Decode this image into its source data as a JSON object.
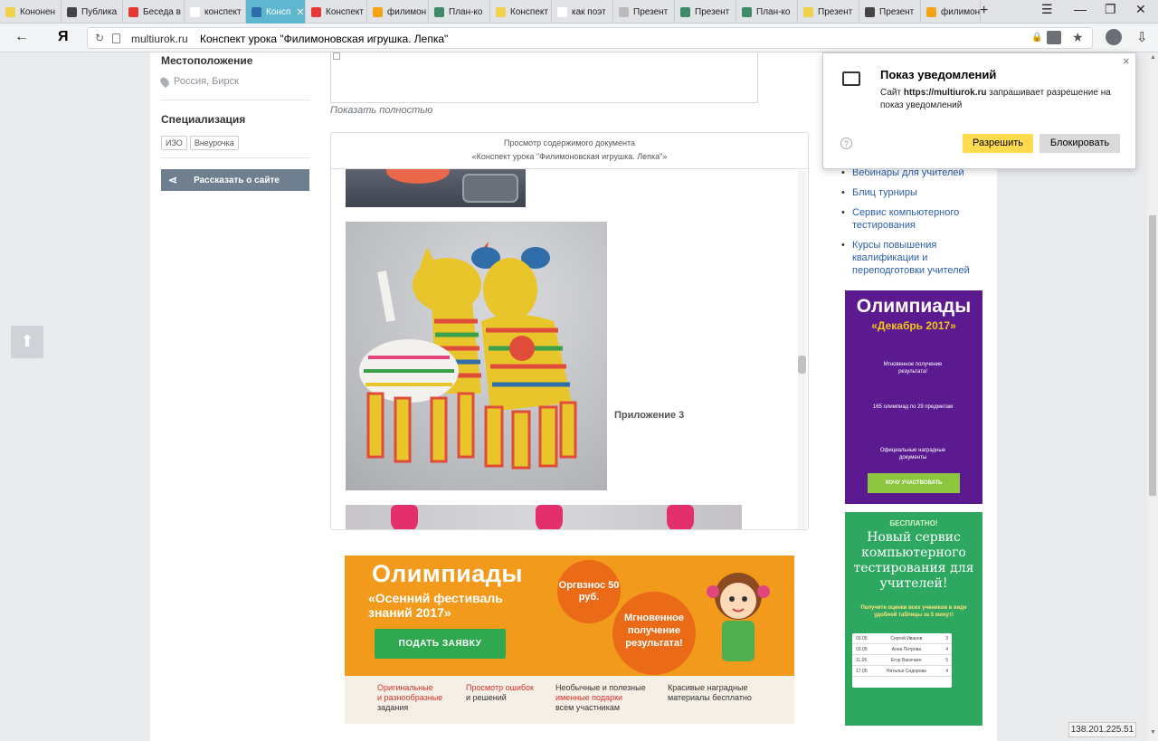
{
  "tabs": [
    {
      "label": "Кононен",
      "color": "#f0d24a",
      "active": false
    },
    {
      "label": "Публика",
      "color": "#444",
      "active": false
    },
    {
      "label": "Беседа в",
      "color": "#e53935",
      "active": false
    },
    {
      "label": "конспект",
      "color": "#ffffff",
      "active": false
    },
    {
      "label": "Консп",
      "color": "#2f6da8",
      "active": true
    },
    {
      "label": "Конспект",
      "color": "#e53935",
      "active": false
    },
    {
      "label": "филимон",
      "color": "#f2a316",
      "active": false
    },
    {
      "label": "План-ко",
      "color": "#3f8a6b",
      "active": false
    },
    {
      "label": "Конспект",
      "color": "#f0d24a",
      "active": false
    },
    {
      "label": "как поэт",
      "color": "#ffffff",
      "active": false
    },
    {
      "label": "Презент",
      "color": "#bbb",
      "active": false
    },
    {
      "label": "Презент",
      "color": "#3f8a6b",
      "active": false
    },
    {
      "label": "План-ко",
      "color": "#3f8a6b",
      "active": false
    },
    {
      "label": "Презент",
      "color": "#f0d24a",
      "active": false
    },
    {
      "label": "Презент",
      "color": "#444",
      "active": false
    },
    {
      "label": "филимон",
      "color": "#f2a316",
      "active": false
    }
  ],
  "tab_close": "✕",
  "new_tab": "+",
  "window_controls": {
    "menu": "☰",
    "minimize": "—",
    "restore": "❐",
    "close": "✕"
  },
  "address": {
    "logo": "Я",
    "domain": "multiurok.ru",
    "title": "Конспект урока \"Филимоновская игрушка. Лепка\""
  },
  "sidebar": {
    "location_heading": "Местоположение",
    "location_value": "Россия, Бирск",
    "spec_heading": "Специализация",
    "tags": [
      "ИЗО",
      "Внеурочка"
    ],
    "share_label": "Рассказать о сайте"
  },
  "document": {
    "show_full": "Показать полностью",
    "viewer_title": "Просмотр содержимого документа",
    "viewer_subtitle": "«Конспект урока \"Филимоновская игрушка. Лепка\"»",
    "photo_caption": "Приложение 3"
  },
  "banner": {
    "title": "Олимпиады",
    "subtitle": "«Осенний фестиваль знаний 2017»",
    "circle1": "Оргвзнос 50 руб.",
    "circle2": "Мгновенное получение результата!",
    "button": "ПОДАТЬ ЗАЯВКУ",
    "features": [
      {
        "a": "Оригинальные",
        "b": "и разнообразные",
        "c": "задания"
      },
      {
        "a": "Просмотр ошибок",
        "b": "и решений",
        "c": ""
      },
      {
        "a": "Необычные и полезные",
        "b": "именные подарки",
        "c": "всем участникам"
      },
      {
        "a": "Красивые наградные",
        "b": "материалы бесплатно",
        "c": ""
      }
    ]
  },
  "right_links": [
    "Вебинары для учителей",
    "Блиц турниры",
    "Сервис компьютерного тестирования",
    "Курсы повышения квалификации и переподготовки учителей"
  ],
  "ad_olymp": {
    "title": "Олимпиады",
    "subtitle": "«Декабрь 2017»",
    "line1": "Мгновенное получение результата!",
    "line2": "165 олимпиад по 29 предметам",
    "line3": "Официальные наградные документы",
    "button": "ХОЧУ УЧАСТВОВАТЬ"
  },
  "ad_test": {
    "free": "БЕСПЛАТНО!",
    "title": "Новый сервис компьютерного тестирования для учителей!",
    "text": "Получите оценки всех учеников в виде удобной таблицы за 5 минут!",
    "rows": [
      {
        "date": "03.05",
        "name": "Сергей Иванов",
        "grade": "3"
      },
      {
        "date": "03.05",
        "name": "Анна Петрова",
        "grade": "4"
      },
      {
        "date": "11.05",
        "name": "Егор Васечкин",
        "grade": "5"
      },
      {
        "date": "17.05",
        "name": "Наталья Сидорова",
        "grade": "4"
      }
    ]
  },
  "notification": {
    "title": "Показ уведомлений",
    "body_prefix": "Сайт ",
    "body_site": "https://multiurok.ru",
    "body_suffix": " запрашивает разрешение на показ уведомлений",
    "allow": "Разрешить",
    "block": "Блокировать",
    "help": "?",
    "close": "×"
  },
  "ip_address": "138.201.225.51",
  "colors": {
    "accent_tab": "#5fb6cf",
    "allow_button": "#ffdb4d",
    "share_button": "#6f7f8f",
    "banner_orange": "#f29a1b",
    "link_blue": "#2b5ea7"
  }
}
